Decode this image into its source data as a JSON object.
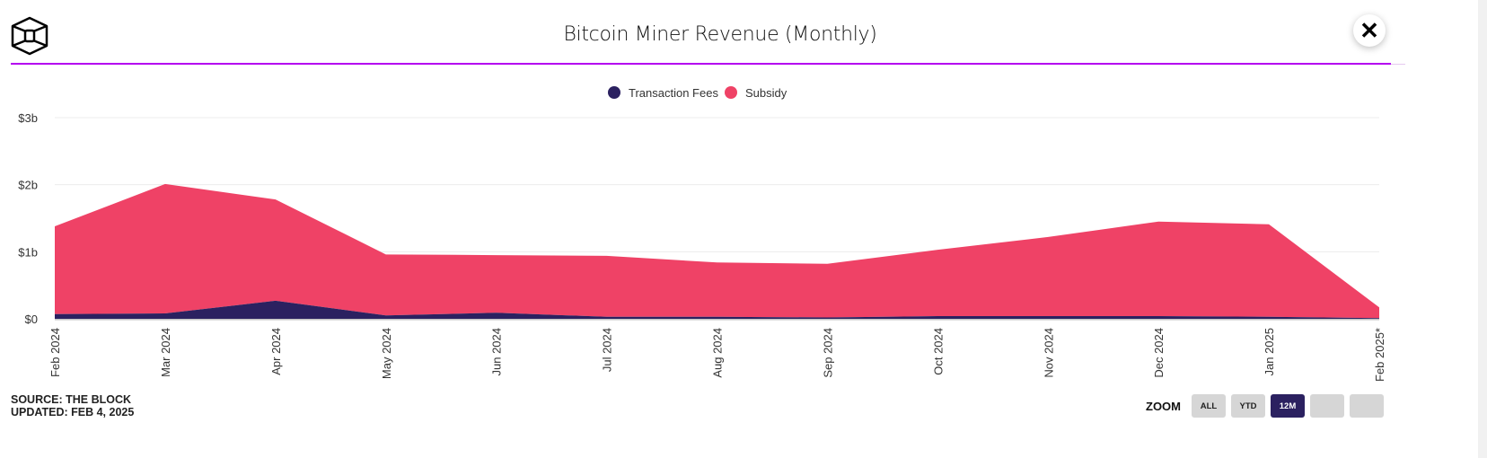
{
  "header": {
    "title": "Bitcoin Miner Revenue (Monthly)",
    "logo": "The Block cube logo",
    "close_icon": "close-icon"
  },
  "footer": {
    "source": "SOURCE: THE BLOCK",
    "updated": "UPDATED: FEB 4, 2025"
  },
  "zoom": {
    "label": "ZOOM",
    "buttons": [
      {
        "label": "ALL",
        "active": false
      },
      {
        "label": "YTD",
        "active": false
      },
      {
        "label": "12M",
        "active": true
      },
      {
        "label": "",
        "active": false
      },
      {
        "label": "",
        "active": false
      }
    ]
  },
  "colors": {
    "fees": "#2b2160",
    "subsidy": "#ef4266",
    "accent": "#b400f0"
  },
  "chart_data": {
    "type": "area",
    "stacked": true,
    "title": "Bitcoin Miner Revenue (Monthly)",
    "categories": [
      "Feb 2024",
      "Mar 2024",
      "Apr 2024",
      "May 2024",
      "Jun 2024",
      "Jul 2024",
      "Aug 2024",
      "Sep 2024",
      "Oct 2024",
      "Nov 2024",
      "Dec 2024",
      "Jan 2025",
      "Feb 2025*"
    ],
    "series": [
      {
        "name": "Transaction Fees",
        "color": "#2b2160",
        "values": [
          0.07,
          0.08,
          0.27,
          0.05,
          0.09,
          0.03,
          0.03,
          0.02,
          0.04,
          0.04,
          0.04,
          0.03,
          0.01
        ]
      },
      {
        "name": "Subsidy",
        "color": "#ef4266",
        "values": [
          1.31,
          1.93,
          1.51,
          0.91,
          0.86,
          0.91,
          0.81,
          0.8,
          0.99,
          1.18,
          1.41,
          1.38,
          0.16
        ]
      }
    ],
    "unit": "billion USD",
    "yticks": [
      {
        "v": 0,
        "label": "$0"
      },
      {
        "v": 1,
        "label": "$1b"
      },
      {
        "v": 2,
        "label": "$2b"
      },
      {
        "v": 3,
        "label": "$3b"
      }
    ],
    "ylim": [
      0,
      3
    ],
    "grid": true,
    "legend": "top-center"
  }
}
